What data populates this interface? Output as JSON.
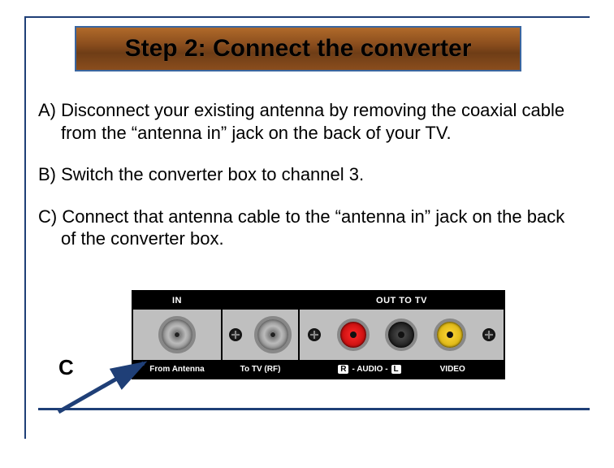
{
  "title": "Step 2: Connect the converter",
  "steps": {
    "a": "A) Disconnect your existing antenna by removing the coaxial cable from the “antenna in” jack on the back of your TV.",
    "b": "B) Switch the converter box to channel 3.",
    "c": "C) Connect that antenna cable to the “antenna in” jack on the back of the converter box."
  },
  "callout_letter": "C",
  "diagram": {
    "in_header": "IN",
    "out_header": "OUT TO TV",
    "from_antenna": "From Antenna",
    "to_tv_rf": "To TV (RF)",
    "audio_r": "R",
    "audio_mid": " - AUDIO - ",
    "audio_l": "L",
    "video": "VIDEO"
  }
}
